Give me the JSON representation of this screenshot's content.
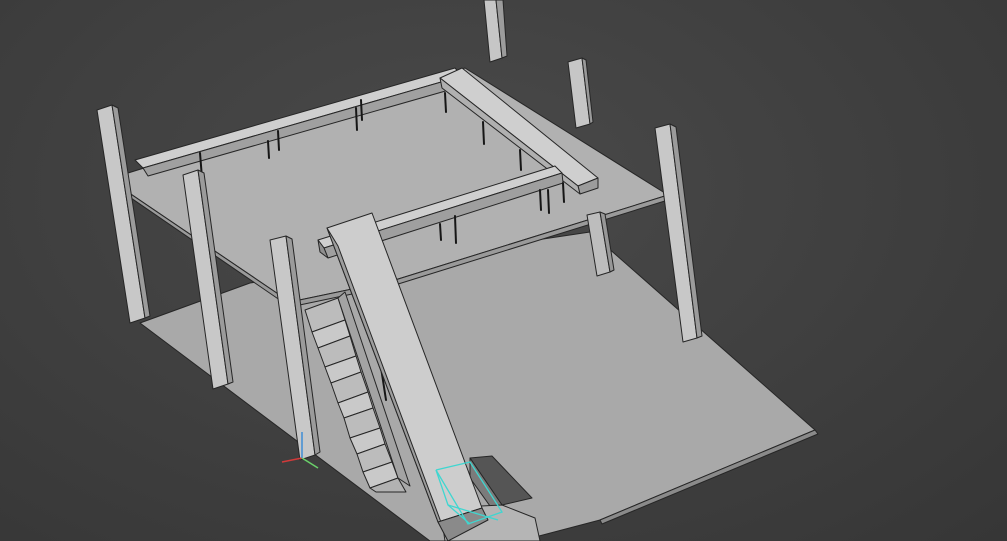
{
  "viewport": {
    "background": "#3f3f3f",
    "model_face_light": "#c2c2c2",
    "model_face_mid": "#a5a5a5",
    "model_face_dark": "#8c8c8c",
    "selection_color": "#3fd6d0",
    "axis_x_color": "#d23a3a",
    "axis_y_color": "#6ad06a",
    "axis_z_color": "#3f8ed6"
  }
}
